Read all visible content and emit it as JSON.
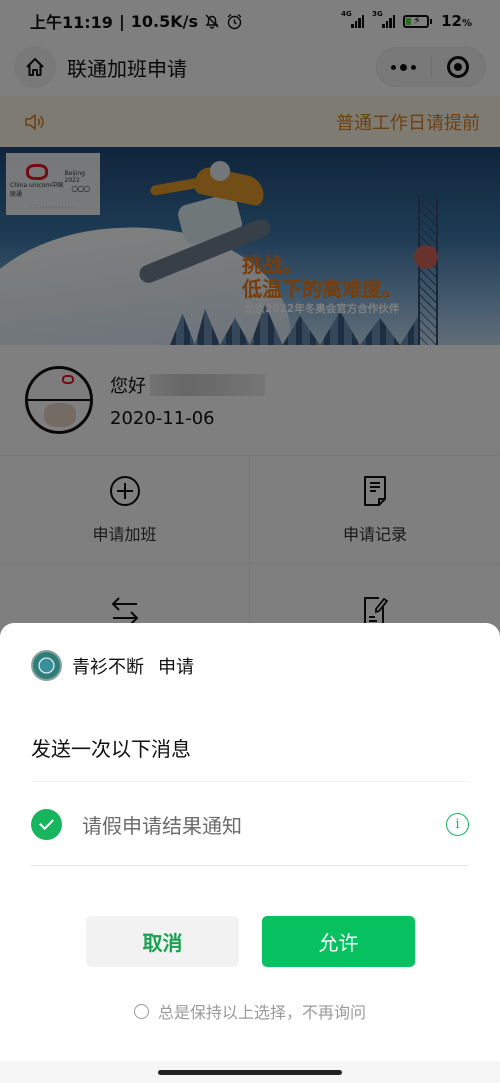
{
  "statusbar": {
    "time": "上午11:19",
    "net_speed": "10.5K/s",
    "sim1": "4G",
    "sim2": "3G",
    "battery": "12",
    "battery_unit": "%"
  },
  "navbar": {
    "title": "联通加班申请"
  },
  "notice": {
    "text": "普通工作日请提前"
  },
  "banner": {
    "slogan_line1": "挑战。",
    "slogan_line2": "低温下的高难度。",
    "subtitle": "北京2022年冬奥会官方合作伙伴",
    "brand": "China unicom中国联通",
    "olympic": "Beijing 2022"
  },
  "profile": {
    "greeting": "您好",
    "date": "2020-11-06"
  },
  "menu": [
    {
      "label": "申请加班",
      "icon": "plus-circle-icon"
    },
    {
      "label": "申请记录",
      "icon": "document-icon"
    },
    {
      "label": "",
      "icon": "swap-arrows-icon"
    },
    {
      "label": "",
      "icon": "edit-document-icon"
    }
  ],
  "sheet": {
    "app_name": "青衫不断",
    "action": "申请",
    "title": "发送一次以下消息",
    "option_label": "请假申请结果通知",
    "option_checked": true,
    "cancel_label": "取消",
    "allow_label": "允许",
    "remember_label": "总是保持以上选择，不再询问",
    "remember_checked": false
  },
  "colors": {
    "accent_green": "#07c160",
    "notice_orange": "#d9822b",
    "slogan_orange": "#f07b11"
  }
}
